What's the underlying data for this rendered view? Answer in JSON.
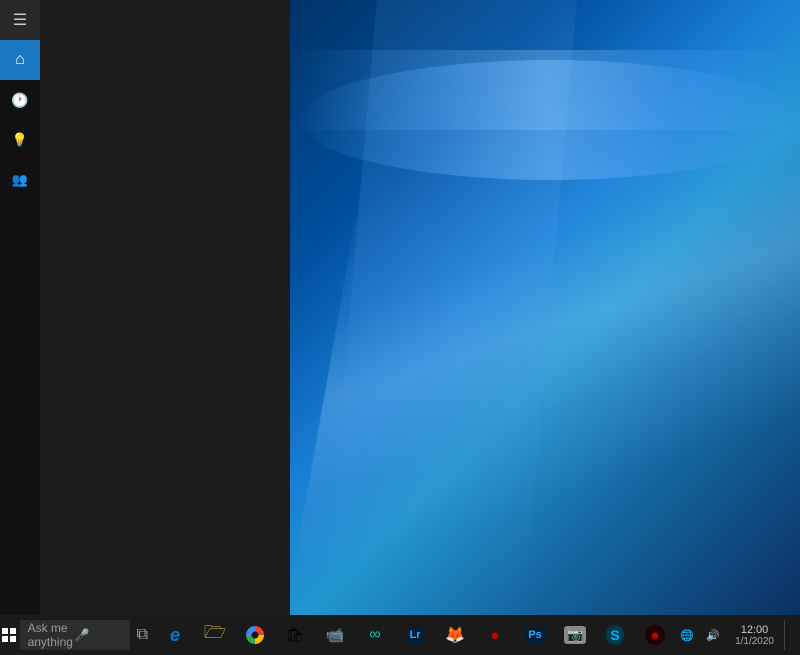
{
  "desktop": {
    "background_desc": "Windows 10 dark blue wallpaper"
  },
  "start_menu": {
    "visible": true
  },
  "sidebar": {
    "items": [
      {
        "id": "hamburger",
        "icon": "☰",
        "label": "Menu",
        "active": false
      },
      {
        "id": "home",
        "icon": "⌂",
        "label": "Home",
        "active": true
      },
      {
        "id": "recent",
        "icon": "🕐",
        "label": "Recent",
        "active": false
      },
      {
        "id": "explore",
        "icon": "◉",
        "label": "Explore",
        "active": false
      },
      {
        "id": "people",
        "icon": "👥",
        "label": "People",
        "active": false
      }
    ]
  },
  "taskbar": {
    "search_placeholder": "Ask me anything",
    "apps": [
      {
        "id": "edge",
        "label": "Microsoft Edge",
        "icon": "e"
      },
      {
        "id": "explorer",
        "label": "File Explorer",
        "icon": "📁"
      },
      {
        "id": "chrome",
        "label": "Google Chrome",
        "icon": "chrome"
      },
      {
        "id": "store",
        "label": "Microsoft Store",
        "icon": "🛍"
      },
      {
        "id": "meet",
        "label": "Meet Now",
        "icon": "📹"
      },
      {
        "id": "unknown1",
        "label": "App",
        "icon": "∞"
      },
      {
        "id": "lightroom",
        "label": "Lightroom",
        "icon": "Lr"
      },
      {
        "id": "firefox",
        "label": "Firefox",
        "icon": "🦊"
      },
      {
        "id": "unknown2",
        "label": "App",
        "icon": "🔴"
      },
      {
        "id": "photoshop",
        "label": "Photoshop",
        "icon": "Ps"
      },
      {
        "id": "unknown3",
        "label": "App",
        "icon": "📷"
      },
      {
        "id": "skype",
        "label": "Skype",
        "icon": "S"
      },
      {
        "id": "unknown4",
        "label": "App",
        "icon": "🔴"
      }
    ],
    "clock": {
      "time": "12:00",
      "date": "1/1/2020"
    }
  }
}
